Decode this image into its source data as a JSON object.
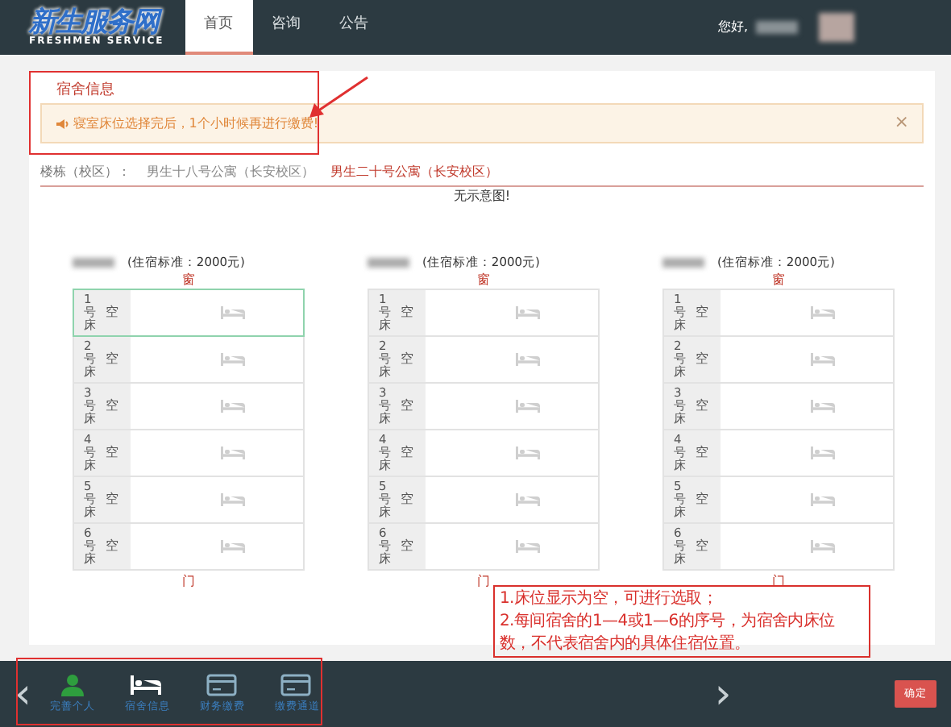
{
  "header": {
    "logo_main": "新生服务网",
    "logo_sub": "FRESHMEN SERVICE",
    "tabs": [
      {
        "label": "首页",
        "selected": true
      },
      {
        "label": "咨询",
        "selected": false
      },
      {
        "label": "公告",
        "selected": false
      }
    ],
    "greeting": "您好,"
  },
  "panel": {
    "title": "宿舍信息",
    "alert": "寝室床位选择完后，1个小时候再进行缴费!",
    "alert_close": "×",
    "building_label": "楼栋（校区）：",
    "buildings": [
      {
        "label": "男生十八号公寓（长安校区）",
        "selected": false
      },
      {
        "label": "男生二十号公寓（长安校区）",
        "selected": true
      }
    ],
    "no_diagram": "无示意图!"
  },
  "rooms": [
    {
      "standard": "(住宿标准：2000元)",
      "window": "窗",
      "door": "门",
      "beds": [
        {
          "label": "1号床",
          "status": "空",
          "selected": true
        },
        {
          "label": "2号床",
          "status": "空",
          "selected": false
        },
        {
          "label": "3号床",
          "status": "空",
          "selected": false
        },
        {
          "label": "4号床",
          "status": "空",
          "selected": false
        },
        {
          "label": "5号床",
          "status": "空",
          "selected": false
        },
        {
          "label": "6号床",
          "status": "空",
          "selected": false
        }
      ]
    },
    {
      "standard": "(住宿标准：2000元)",
      "window": "窗",
      "door": "门",
      "beds": [
        {
          "label": "1号床",
          "status": "空",
          "selected": false
        },
        {
          "label": "2号床",
          "status": "空",
          "selected": false
        },
        {
          "label": "3号床",
          "status": "空",
          "selected": false
        },
        {
          "label": "4号床",
          "status": "空",
          "selected": false
        },
        {
          "label": "5号床",
          "status": "空",
          "selected": false
        },
        {
          "label": "6号床",
          "status": "空",
          "selected": false
        }
      ]
    },
    {
      "standard": "(住宿标准：2000元)",
      "window": "窗",
      "door": "门",
      "beds": [
        {
          "label": "1号床",
          "status": "空",
          "selected": false
        },
        {
          "label": "2号床",
          "status": "空",
          "selected": false
        },
        {
          "label": "3号床",
          "status": "空",
          "selected": false
        },
        {
          "label": "4号床",
          "status": "空",
          "selected": false
        },
        {
          "label": "5号床",
          "status": "空",
          "selected": false
        },
        {
          "label": "6号床",
          "status": "空",
          "selected": false
        }
      ]
    }
  ],
  "note": [
    "1.床位显示为空，可进行选取；",
    "2.每间宿舍的1—4或1—6的序号，为宿舍内床位数，不代表宿舍内的具体住宿位置。"
  ],
  "footer": {
    "prev": "‹",
    "next": "›",
    "steps": [
      {
        "kind": "person",
        "label": "完善个人",
        "color": "#2e9e3e"
      },
      {
        "kind": "bed",
        "label": "宿舍信息",
        "color": "#ffffff"
      },
      {
        "kind": "card",
        "label": "财务缴费",
        "color": "#8db0c4"
      },
      {
        "kind": "card",
        "label": "缴费通道",
        "color": "#8db0c4"
      }
    ],
    "confirm": "确定"
  }
}
